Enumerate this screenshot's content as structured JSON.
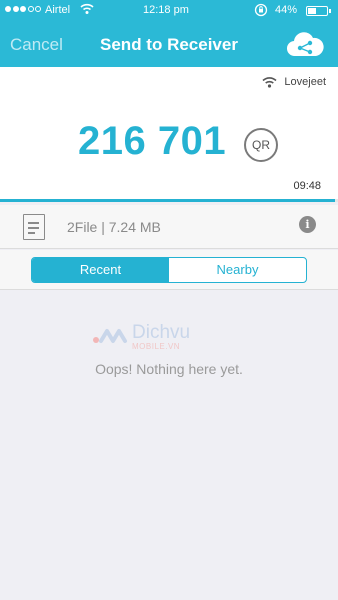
{
  "status_bar": {
    "carrier": "Airtel",
    "time": "12:18 pm",
    "battery": "44%",
    "signal_bars_filled": 3,
    "signal_bars_total": 5,
    "battery_level": 0.44
  },
  "nav": {
    "cancel_label": "Cancel",
    "title": "Send to Receiver",
    "share_icon": "cloud-share-icon"
  },
  "connection": {
    "network_name": "Lovejeet",
    "icon": "wifi-icon"
  },
  "transfer": {
    "code": "216 701",
    "qr_label": "QR",
    "countdown": "09:48",
    "progress": 0.99
  },
  "file": {
    "summary": "2File | 7.24 MB",
    "icon": "document-icon",
    "info_icon": "info-icon"
  },
  "tabs": [
    {
      "label": "Recent",
      "active": true
    },
    {
      "label": "Nearby",
      "active": false
    }
  ],
  "empty_state": {
    "message": "Oops! Nothing here yet."
  },
  "watermark": {
    "brand": "Dichvu",
    "sub": "MOBILE.VN"
  },
  "colors": {
    "accent": "#2bb9d6",
    "code": "#25b2d2",
    "muted": "#8a8a8a"
  }
}
